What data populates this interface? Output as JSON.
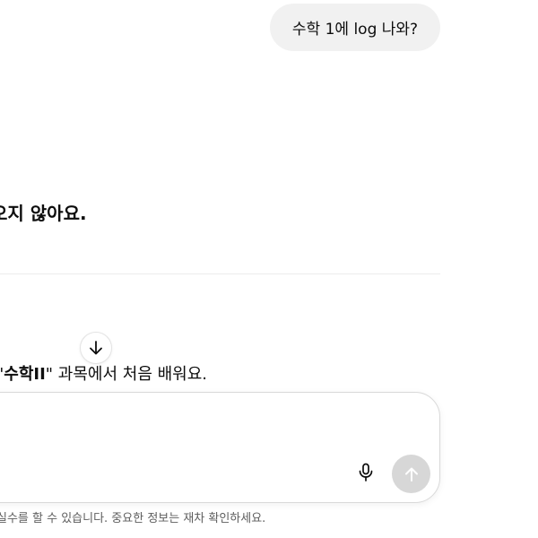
{
  "user_message": {
    "text": "수학 1에 log 나와?"
  },
  "assistant": {
    "heading": "오지 않아요.",
    "line_prefix": "\"",
    "line_bold": "수학II",
    "line_suffix": "\" 과목에서 처음 배워요."
  },
  "scroll_down_icon": "arrow-down-icon",
  "composer": {
    "placeholder": "",
    "mic_icon": "microphone-icon",
    "send_icon": "arrow-up-icon",
    "send_button_color": "#d7d7d7"
  },
  "footer": {
    "disclaimer": "실수를 할 수 있습니다. 중요한 정보는 재차 확인하세요."
  }
}
